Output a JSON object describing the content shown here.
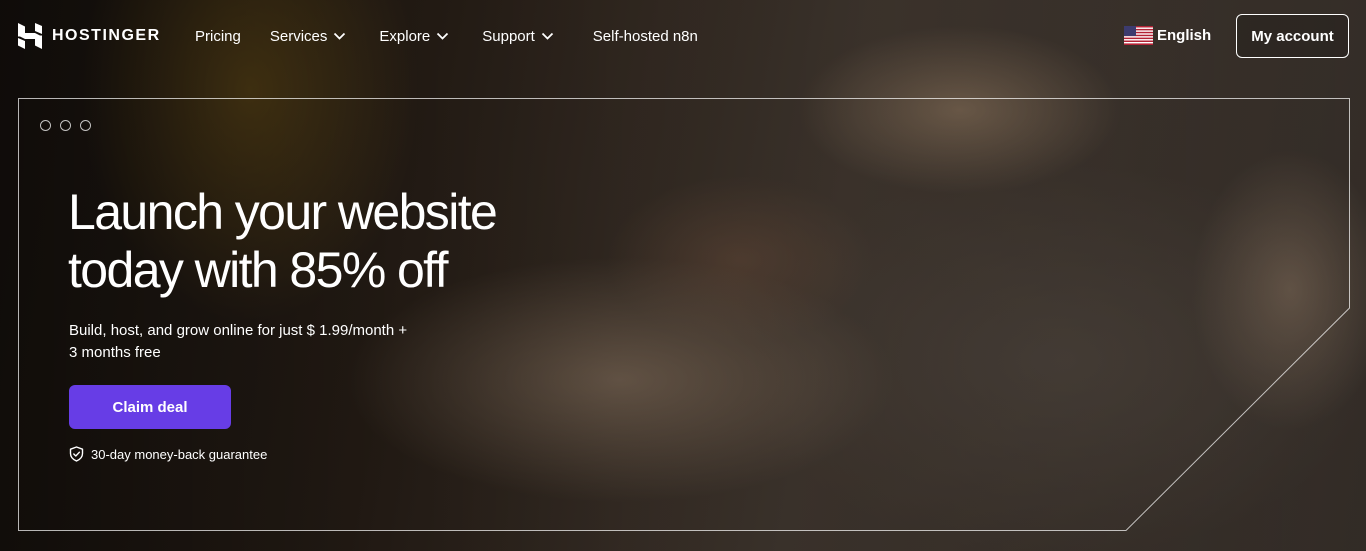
{
  "header": {
    "logo_text": "HOSTINGER",
    "nav": [
      {
        "label": "Pricing",
        "has_dropdown": false
      },
      {
        "label": "Services",
        "has_dropdown": true
      },
      {
        "label": "Explore",
        "has_dropdown": true
      },
      {
        "label": "Support",
        "has_dropdown": true
      },
      {
        "label": "Self-hosted n8n",
        "has_dropdown": false
      }
    ],
    "language": {
      "label": "English",
      "flag": "us-flag-icon"
    },
    "account_button": "My account"
  },
  "hero": {
    "title_line1": "Launch your website",
    "title_line2": "today with 85% off",
    "subtitle_line1": "Build, host, and grow online for just $ 1.99/month +",
    "subtitle_line2": "3 months free",
    "cta_label": "Claim deal",
    "guarantee": "30-day money-back guarantee"
  },
  "colors": {
    "accent": "#673de6",
    "text": "#ffffff"
  }
}
